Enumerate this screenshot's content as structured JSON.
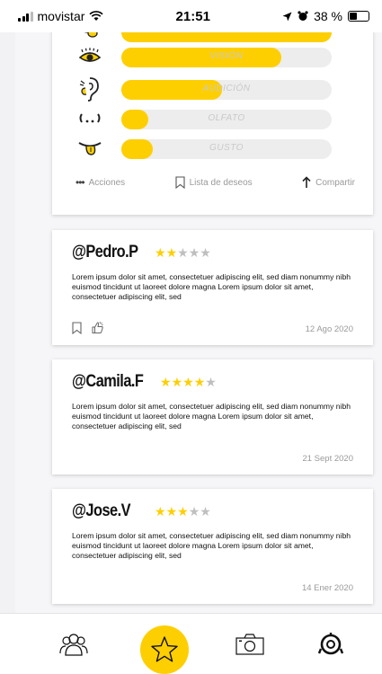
{
  "status": {
    "carrier": "movistar",
    "time": "21:51",
    "battery": "38 %"
  },
  "senses": [
    {
      "name": "",
      "level": 1.0,
      "icon": "tongue-icon-top"
    },
    {
      "name": "VISIÓN",
      "level": 0.76,
      "icon": "eye-icon"
    },
    {
      "name": "AUDICIÓN",
      "level": 0.48,
      "icon": "ear-icon"
    },
    {
      "name": "OLFATO",
      "level": 0.13,
      "icon": "nose-icon"
    },
    {
      "name": "GUSTO",
      "level": 0.15,
      "icon": "tongue-icon"
    }
  ],
  "actions": {
    "more": "Acciones",
    "wishlist": "Lista de deseos",
    "share": "Compartir"
  },
  "reviews": [
    {
      "user": "@Pedro.P",
      "rating": 2,
      "text": "Lorem ipsum dolor sit amet, consectetuer adipiscing elit, sed diam nonummy nibh euismod tincidunt ut laoreet dolore magna Lorem ipsum dolor sit amet, consectetuer adipiscing elit, sed",
      "date": "12 Ago 2020"
    },
    {
      "user": "@Camila.F",
      "rating": 4,
      "text": "Lorem ipsum dolor sit amet, consectetuer adipiscing elit, sed diam nonummy nibh euismod tincidunt ut laoreet dolore magna Lorem ipsum dolor sit amet, consectetuer adipiscing elit, sed",
      "date": "21 Sept 2020"
    },
    {
      "user": "@Jose.V",
      "rating": 3,
      "text": "Lorem ipsum dolor sit amet, consectetuer adipiscing elit, sed diam nonummy nibh euismod tincidunt ut laoreet dolore magna Lorem ipsum dolor sit amet, consectetuer adipiscing elit, sed",
      "date": "14 Ener 2020"
    }
  ],
  "colors": {
    "accent": "#fecf00",
    "track": "#ededee",
    "star_off": "#bfbfbf"
  },
  "nav": [
    "community-icon",
    "favorites-star-icon",
    "camera-icon",
    "profile-sense-icon"
  ]
}
